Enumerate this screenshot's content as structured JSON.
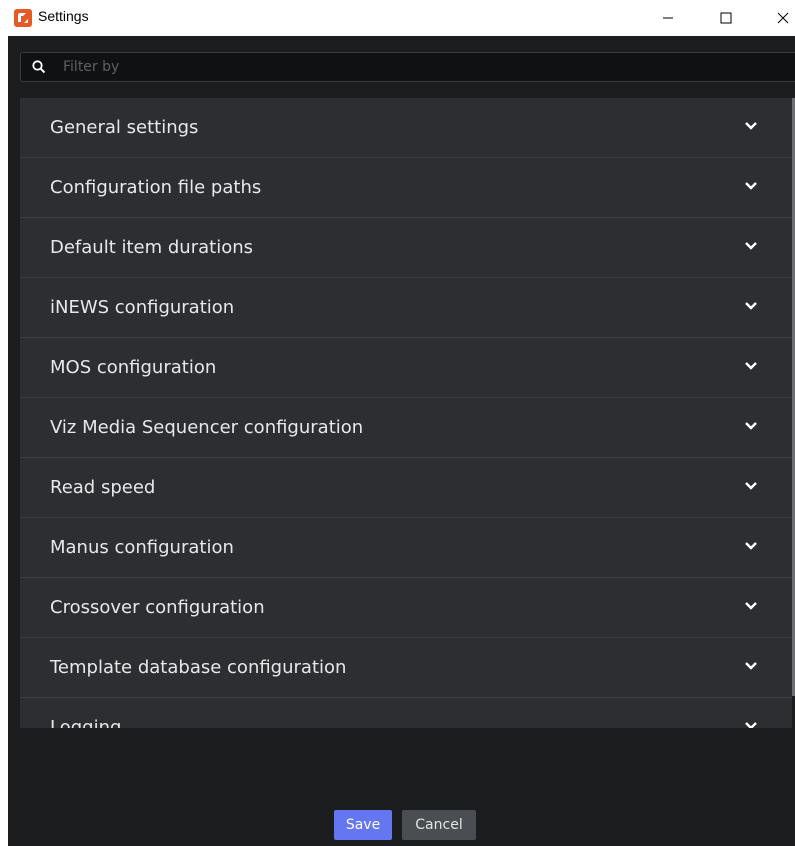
{
  "window": {
    "title": "Settings",
    "minimize_label": "Minimize",
    "maximize_label": "Maximize",
    "close_label": "Close"
  },
  "filter": {
    "placeholder": "Filter by",
    "value": ""
  },
  "sections": [
    {
      "label": "General settings"
    },
    {
      "label": "Configuration file paths"
    },
    {
      "label": "Default item durations"
    },
    {
      "label": "iNEWS configuration"
    },
    {
      "label": "MOS configuration"
    },
    {
      "label": "Viz Media Sequencer configuration"
    },
    {
      "label": "Read speed"
    },
    {
      "label": "Manus configuration"
    },
    {
      "label": "Crossover configuration"
    },
    {
      "label": "Template database configuration"
    },
    {
      "label": "Logging"
    }
  ],
  "footer": {
    "save_label": "Save",
    "cancel_label": "Cancel"
  },
  "colors": {
    "accent": "#6476f0",
    "app_icon": "#e85a24",
    "panel": "#2c2e31",
    "background": "#1c1d1f"
  }
}
